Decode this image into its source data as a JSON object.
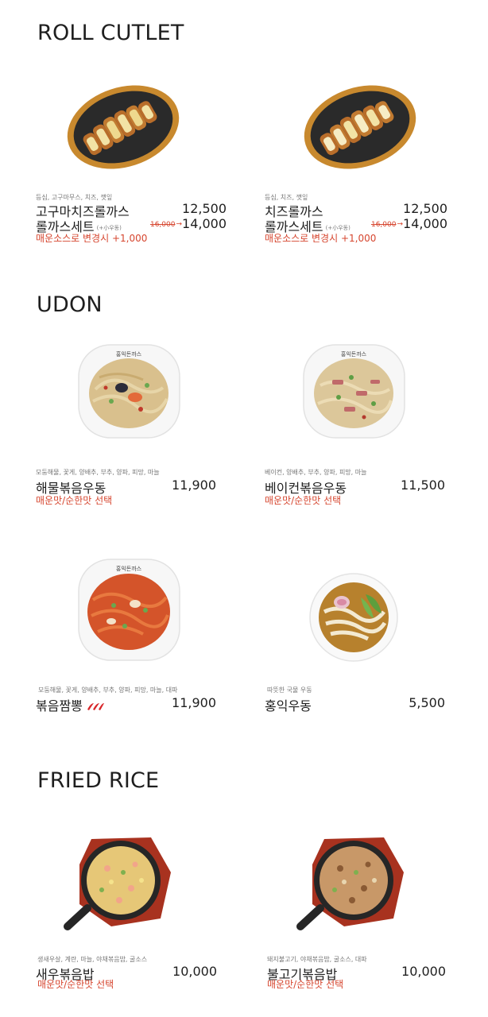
{
  "sections": [
    {
      "title": "ROLL CUTLET",
      "items": [
        {
          "ingredients": "등심, 고구마무스, 치즈, 깻잎",
          "name": "고구마치즈롤까스",
          "price": "12,500",
          "set_name": "롤까스세트",
          "set_note": "(+小우동)",
          "set_old_price": "16,000",
          "set_price": "14,000",
          "note": "매운소스로 변경시 +1,000"
        },
        {
          "ingredients": "등심, 치즈, 깻잎",
          "name": "치즈롤까스",
          "price": "12,500",
          "set_name": "롤까스세트",
          "set_note": "(+小우동)",
          "set_old_price": "16,000",
          "set_price": "14,000",
          "note": "매운소스로 변경시 +1,000"
        }
      ]
    },
    {
      "title": "UDON",
      "items": [
        {
          "ingredients": "모둠해물, 꽃게, 양배추, 부추, 양파, 피망, 마늘",
          "name": "해물볶음우동",
          "price": "11,900",
          "note": "매운맛/순한맛 선택"
        },
        {
          "ingredients": "베이컨, 양배추, 부추, 양파, 피망, 마늘",
          "name": "베이컨볶음우동",
          "price": "11,500",
          "note": "매운맛/순한맛 선택"
        },
        {
          "ingredients": "모둠해물, 꽃게, 양배추, 부추, 양파, 피망, 마늘, 대파",
          "name": "볶음짬뽕",
          "price": "11,900",
          "spicy_icon": "chili-pepper-icon"
        },
        {
          "ingredients": "따뜻한 국물 우동",
          "name": "홍익우동",
          "price": "5,500"
        }
      ]
    },
    {
      "title": "FRIED RICE",
      "items": [
        {
          "ingredients": "생새우살, 계란, 마늘, 야채볶음밥, 굴소스",
          "name": "새우볶음밥",
          "price": "10,000",
          "note": "매운맛/순한맛 선택"
        },
        {
          "ingredients": "돼지불고기, 야채볶음밥, 굴소스, 대파",
          "name": "불고기볶음밥",
          "price": "10,000",
          "note": "매운맛/순한맛 선택"
        }
      ]
    }
  ],
  "plate_brand": "홍익돈까스",
  "colors": {
    "accent_red": "#d6452e",
    "text": "#1e1e1e",
    "muted": "#777777"
  }
}
